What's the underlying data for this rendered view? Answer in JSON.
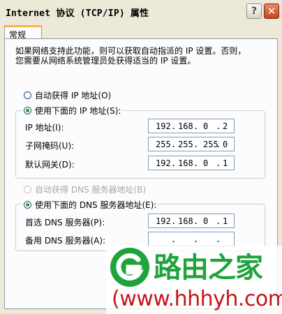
{
  "window": {
    "title": "Internet 协议 (TCP/IP) 属性",
    "help_label": "?",
    "close_label": "✕"
  },
  "tab": {
    "label": "常规"
  },
  "description": {
    "line1": "如果网络支持此功能，则可以获取自动指派的 IP 设置。否则，",
    "line2": "您需要从网络系统管理员处获得适当的 IP 设置。"
  },
  "ip": {
    "auto_label": "自动获得 IP 地址(O)",
    "manual_label": "使用下面的 IP 地址(S):",
    "selected": "manual",
    "fields": [
      {
        "label": "IP 地址(I):",
        "octets": [
          "192",
          "168",
          "0",
          "2"
        ]
      },
      {
        "label": "子网掩码(U):",
        "octets": [
          "255",
          "255",
          "255",
          "0"
        ]
      },
      {
        "label": "默认网关(D):",
        "octets": [
          "192",
          "168",
          "0",
          "1"
        ]
      }
    ]
  },
  "dns": {
    "auto_label": "自动获得 DNS 服务器地址(B)",
    "manual_label": "使用下面的 DNS 服务器地址(E):",
    "selected": "manual",
    "fields": [
      {
        "label": "首选 DNS 服务器(P):",
        "octets": [
          "192",
          "168",
          "0",
          "1"
        ]
      },
      {
        "label": "备用 DNS 服务器(A):",
        "octets": [
          "",
          "",
          "",
          ""
        ]
      }
    ]
  },
  "watermark": {
    "name": "路由之家",
    "url": "(www.hhhyh.com)",
    "green": "#1fa33b",
    "red": "#c7141b"
  }
}
